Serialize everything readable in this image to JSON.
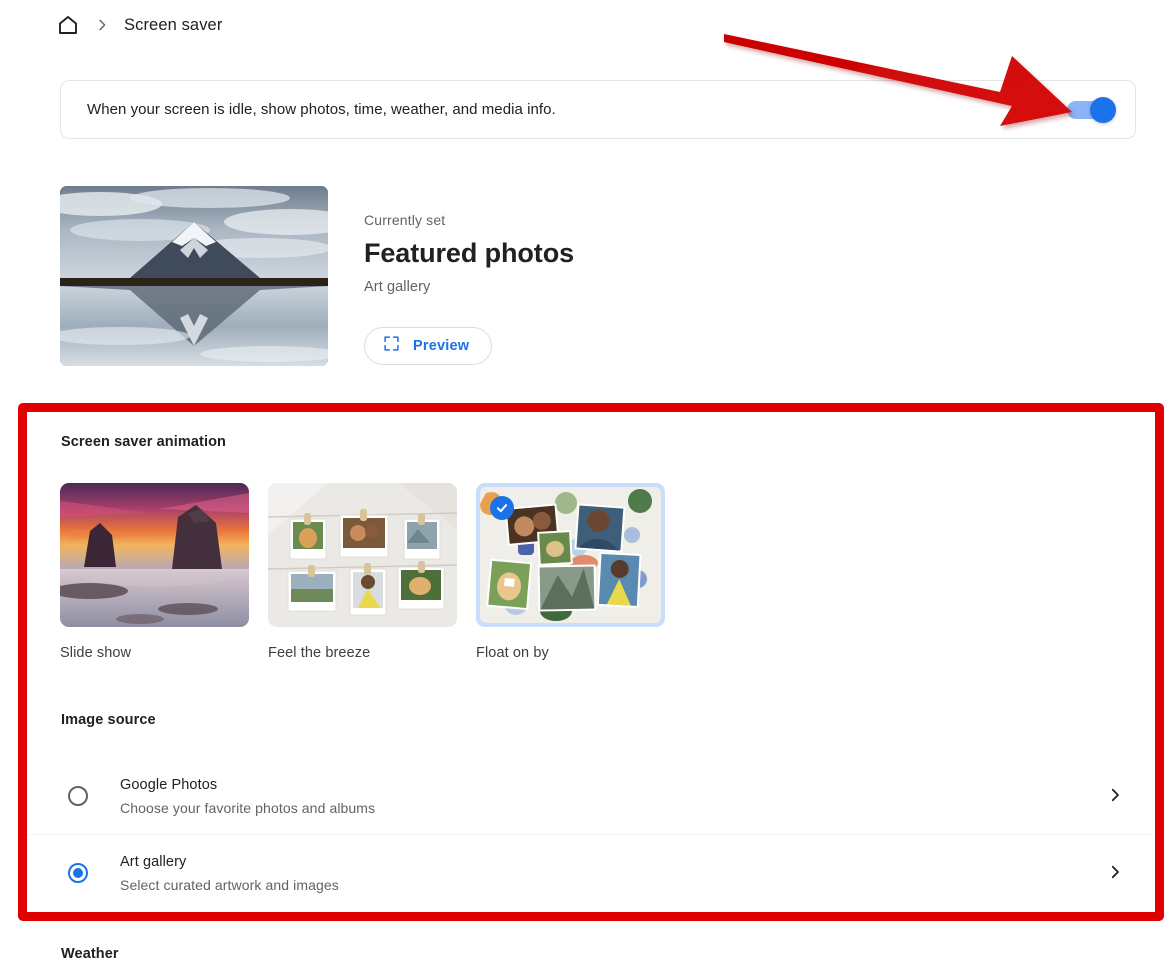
{
  "breadcrumb": {
    "home_icon": "home-icon",
    "separator_icon": "chevron-right-icon",
    "title": "Screen saver"
  },
  "toggle_card": {
    "description": "When your screen is idle, show photos, time, weather, and media info.",
    "toggle_state": "on",
    "toggle_color": "#1a73e8",
    "toggle_track_color": "#8ab4f8"
  },
  "currently_set": {
    "label": "Currently set",
    "title": "Featured photos",
    "subtitle": "Art gallery",
    "thumbnail_alt": "mountain-reflection-photo",
    "preview_button": {
      "label": "Preview",
      "icon": "fullscreen-icon",
      "text_color": "#1a73e8"
    }
  },
  "animation_section": {
    "heading": "Screen saver animation",
    "options": [
      {
        "label": "Slide show",
        "selected": false,
        "thumbnail_alt": "sunset-sea-stacks-photo"
      },
      {
        "label": "Feel the breeze",
        "selected": false,
        "thumbnail_alt": "photos-on-clothesline"
      },
      {
        "label": "Float on by",
        "selected": true,
        "thumbnail_alt": "floating-photo-collage"
      }
    ],
    "selected_check_icon": "check-icon"
  },
  "image_source_section": {
    "heading": "Image source",
    "rows": [
      {
        "title": "Google Photos",
        "description": "Choose your favorite photos and albums",
        "selected": false,
        "chevron_icon": "chevron-right-icon"
      },
      {
        "title": "Art gallery",
        "description": "Select curated artwork and images",
        "selected": true,
        "chevron_icon": "chevron-right-icon"
      }
    ]
  },
  "weather_section": {
    "heading": "Weather"
  },
  "annotations": {
    "highlight_box_color": "#e00000",
    "arrow_color": "#cc0000",
    "arrow_name": "red-pointer-arrow"
  }
}
